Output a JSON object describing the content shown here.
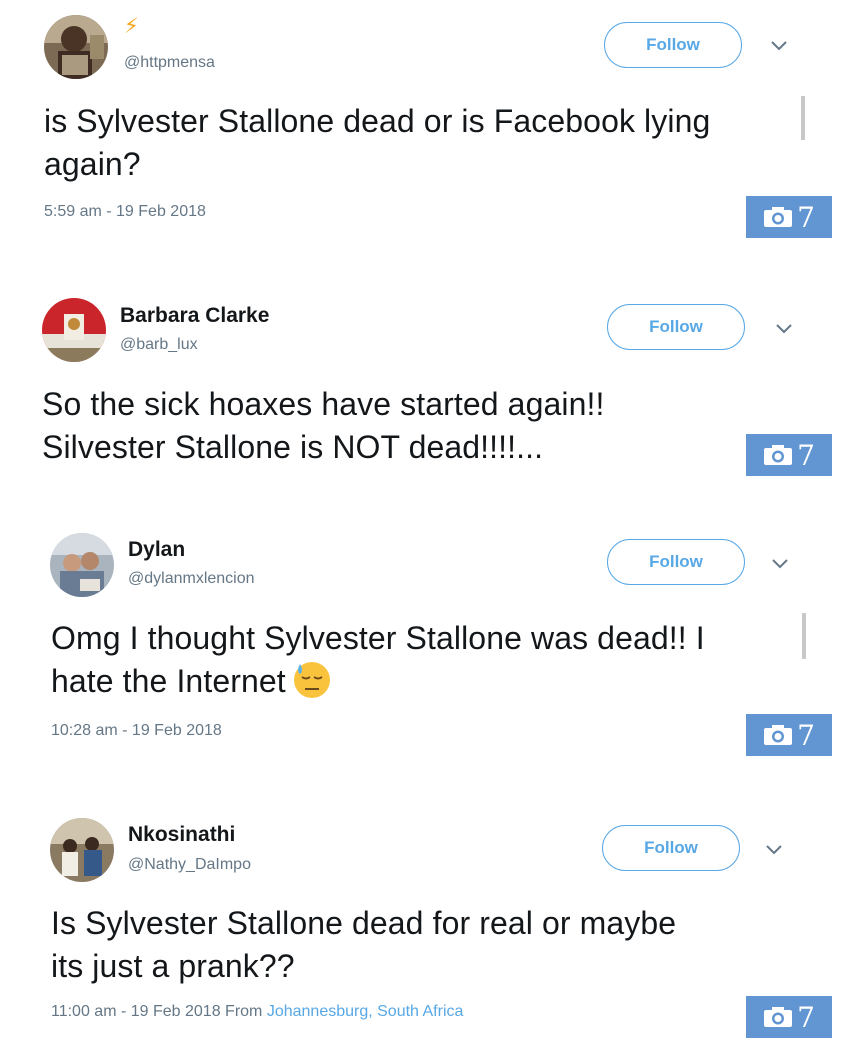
{
  "tweets": [
    {
      "name": "⚡",
      "handle": "@httpmensa",
      "follow_label": "Follow",
      "text_lines": [
        "is Sylvester Stallone dead or is Facebook lying",
        "again?"
      ],
      "timestamp": "5:59 am - 19 Feb 2018",
      "photo_count": "7"
    },
    {
      "name": "Barbara Clarke",
      "handle": "@barb_lux",
      "follow_label": "Follow",
      "text_lines": [
        "So the sick hoaxes have started again!!",
        "Silvester Stallone is NOT dead!!!!..."
      ],
      "timestamp": "",
      "photo_count": "7"
    },
    {
      "name": "Dylan",
      "handle": "@dylanmxlencion",
      "follow_label": "Follow",
      "text_lines": [
        "Omg I thought Sylvester Stallone was dead!! I",
        "hate the Internet"
      ],
      "timestamp": "10:28 am - 19 Feb 2018",
      "photo_count": "7"
    },
    {
      "name": "Nkosinathi",
      "handle": "@Nathy_DaImpo",
      "follow_label": "Follow",
      "text_lines": [
        "Is Sylvester Stallone dead for real or maybe",
        "its just a prank??"
      ],
      "timestamp": "11:00 am - 19 Feb 2018 From",
      "location": "Johannesburg, South Africa",
      "photo_count": "7"
    }
  ],
  "colors": {
    "accent": "#58a8e6",
    "photo_badge": "#6196d2",
    "muted_text": "#657786"
  },
  "icons": [
    "chevron-down-icon",
    "camera-icon",
    "emoji-downcast-sweat-icon"
  ]
}
